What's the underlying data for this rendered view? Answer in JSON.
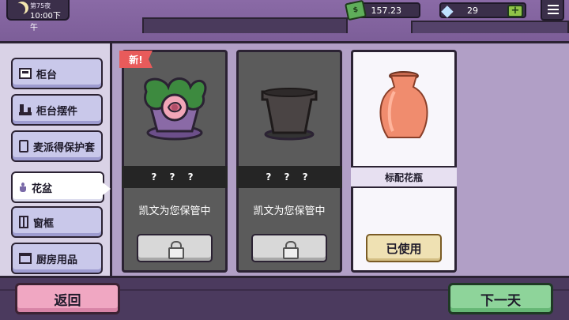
{
  "hud": {
    "day": "第75夜",
    "time": "10:00下午",
    "money": "157.23",
    "gems": "29",
    "plus_label": "+"
  },
  "sidebar": {
    "items": [
      {
        "label": "柜台",
        "icon": "cabinet-icon"
      },
      {
        "label": "柜台摆件",
        "icon": "decor-icon"
      },
      {
        "label": "麦派得保护套",
        "icon": "phone-case-icon"
      },
      {
        "label": "花盆",
        "icon": "flowerpot-icon",
        "active": true
      },
      {
        "label": "窗框",
        "icon": "window-icon"
      },
      {
        "label": "厨房用品",
        "icon": "kitchen-icon"
      }
    ]
  },
  "cards": [
    {
      "tag": "新!",
      "name": "? ? ?",
      "status": "凯文为您保管中",
      "locked": true,
      "image": "rose-pot"
    },
    {
      "name": "? ? ?",
      "status": "凯文为您保管中",
      "locked": true,
      "image": "black-pot"
    },
    {
      "name": "标配花瓶",
      "button": "已使用",
      "locked": false,
      "image": "terracotta-vase"
    }
  ],
  "buttons": {
    "back": "返回",
    "next_day": "下一天"
  },
  "colors": {
    "background": "#6b4f86",
    "panel": "#b19fc6",
    "locked_card": "#5b5b5b",
    "owned_card": "#f8f6fb",
    "new_tag": "#e85b5b",
    "back_button": "#f0a7c2",
    "next_button": "#8ed49a"
  }
}
